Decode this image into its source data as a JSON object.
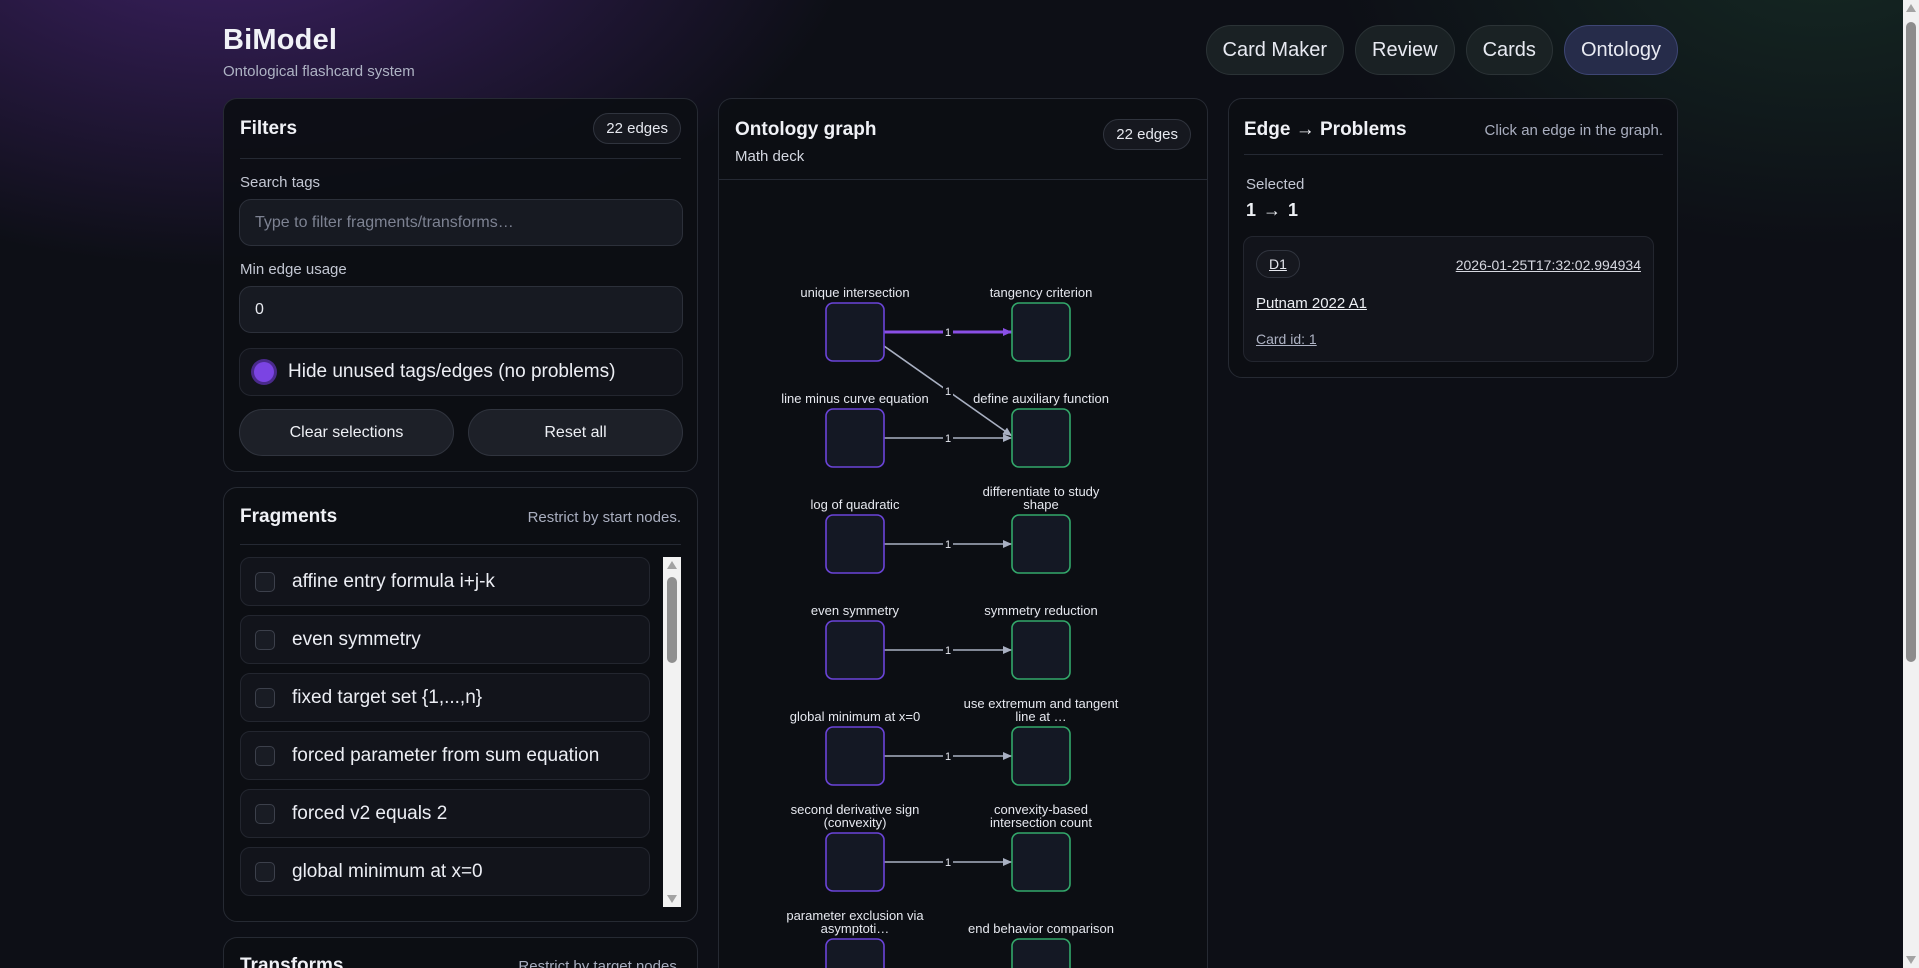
{
  "app": {
    "title": "BiModel",
    "subtitle": "Ontological flashcard system"
  },
  "nav": [
    {
      "label": "Card Maker",
      "active": false
    },
    {
      "label": "Review",
      "active": false
    },
    {
      "label": "Cards",
      "active": false
    },
    {
      "label": "Ontology",
      "active": true
    }
  ],
  "filters": {
    "title": "Filters",
    "edge_count": "22 edges",
    "search_label": "Search tags",
    "search_placeholder": "Type to filter fragments/transforms…",
    "search_value": "",
    "min_edge_label": "Min edge usage",
    "min_edge_value": "0",
    "hide_unused_label": "Hide unused tags/edges (no problems)",
    "hide_unused_checked": true,
    "clear_label": "Clear selections",
    "reset_label": "Reset all"
  },
  "fragments": {
    "title": "Fragments",
    "hint": "Restrict by start nodes.",
    "items": [
      {
        "label": "affine entry formula i+j-k",
        "checked": false
      },
      {
        "label": "even symmetry",
        "checked": false
      },
      {
        "label": "fixed target set {1,...,n}",
        "checked": false
      },
      {
        "label": "forced parameter from sum equation",
        "checked": false
      },
      {
        "label": "forced v2 equals 2",
        "checked": false
      },
      {
        "label": "global minimum at x=0",
        "checked": false
      }
    ]
  },
  "transforms": {
    "title": "Transforms",
    "hint": "Restrict by target nodes."
  },
  "graph": {
    "title": "Ontology graph",
    "subtitle": "Math deck",
    "edge_count": "22 edges",
    "colors": {
      "start_node": "#6b44d9",
      "end_node": "#33a86b",
      "edge": "#a9b0c2",
      "selected_edge": "#8a4fe6"
    },
    "start_nodes": [
      "unique intersection",
      "line minus curve equation",
      "log of quadratic",
      "even symmetry",
      "global minimum at x=0",
      "second derivative sign (convexity)",
      "parameter exclusion via asymptoti…"
    ],
    "end_nodes": [
      "tangency criterion",
      "define auxiliary function",
      "differentiate to study shape",
      "symmetry reduction",
      "use extremum and tangent line at …",
      "convexity-based intersection count",
      "end behavior comparison"
    ],
    "edges": [
      {
        "from": 0,
        "to": 0,
        "weight": "1",
        "selected": true
      },
      {
        "from": 0,
        "to": 1,
        "weight": "1",
        "selected": false
      },
      {
        "from": 1,
        "to": 1,
        "weight": "1",
        "selected": false
      },
      {
        "from": 2,
        "to": 2,
        "weight": "1",
        "selected": false
      },
      {
        "from": 3,
        "to": 3,
        "weight": "1",
        "selected": false
      },
      {
        "from": 4,
        "to": 4,
        "weight": "1",
        "selected": false
      },
      {
        "from": 5,
        "to": 5,
        "weight": "1",
        "selected": false
      }
    ]
  },
  "edge_problems": {
    "title": "Edge → Problems",
    "hint": "Click an edge in the graph.",
    "selected_label": "Selected",
    "selected_value": "1 → 1",
    "card": {
      "badge": "D1",
      "timestamp": "2026-01-25T17:32:02.994934",
      "problem": "Putnam 2022 A1",
      "card_id": "Card id: 1"
    }
  }
}
